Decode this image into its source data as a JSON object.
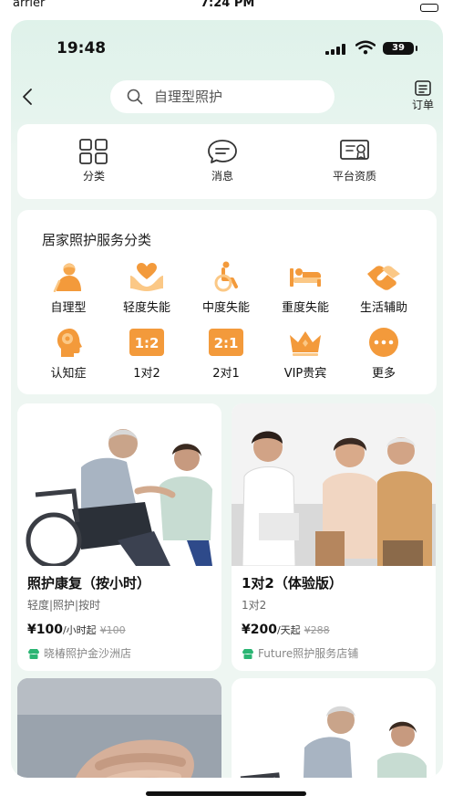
{
  "outer_status": {
    "carrier": "arrier",
    "time": "7:24 PM"
  },
  "status_bar": {
    "time": "19:48",
    "battery": "39"
  },
  "header": {
    "search_placeholder": "自理型照护",
    "order_label": "订单"
  },
  "quick_menu": [
    {
      "label": "分类",
      "icon": "grid-icon"
    },
    {
      "label": "消息",
      "icon": "message-icon"
    },
    {
      "label": "平台资质",
      "icon": "certificate-icon"
    }
  ],
  "category_section": {
    "title": "居家照护服务分类",
    "items": [
      {
        "label": "自理型",
        "icon": "elderly-icon"
      },
      {
        "label": "轻度失能",
        "icon": "heart-hand-icon"
      },
      {
        "label": "中度失能",
        "icon": "wheelchair-icon"
      },
      {
        "label": "重度失能",
        "icon": "bed-icon"
      },
      {
        "label": "生活辅助",
        "icon": "handshake-icon"
      },
      {
        "label": "认知症",
        "icon": "head-icon"
      },
      {
        "label": "1对2",
        "icon": "ratio-1-2-icon",
        "glyph": "1:2"
      },
      {
        "label": "2对1",
        "icon": "ratio-2-1-icon",
        "glyph": "2:1"
      },
      {
        "label": "VIP贵宾",
        "icon": "crown-icon"
      },
      {
        "label": "更多",
        "icon": "more-icon"
      }
    ]
  },
  "products": [
    {
      "title": "照护康复（按小时）",
      "tags": "轻度|照护|按时",
      "price": "¥100",
      "unit": "/小时起",
      "old_price": "¥100",
      "store": "晓椿照护金沙洲店"
    },
    {
      "title": "1对2（体验版）",
      "tags": "1对2",
      "price": "¥200",
      "unit": "/天起",
      "old_price": "¥288",
      "store": "Future照护服务店铺"
    },
    {
      "title": "",
      "tags": "",
      "price": "",
      "unit": "",
      "old_price": "",
      "store": ""
    },
    {
      "title": "",
      "tags": "",
      "price": "",
      "unit": "",
      "old_price": "",
      "store": ""
    }
  ],
  "colors": {
    "accent": "#f39a3b",
    "accent_light": "#fbc886",
    "header_bg": "#dff2ea",
    "store_icon": "#2bb573"
  }
}
